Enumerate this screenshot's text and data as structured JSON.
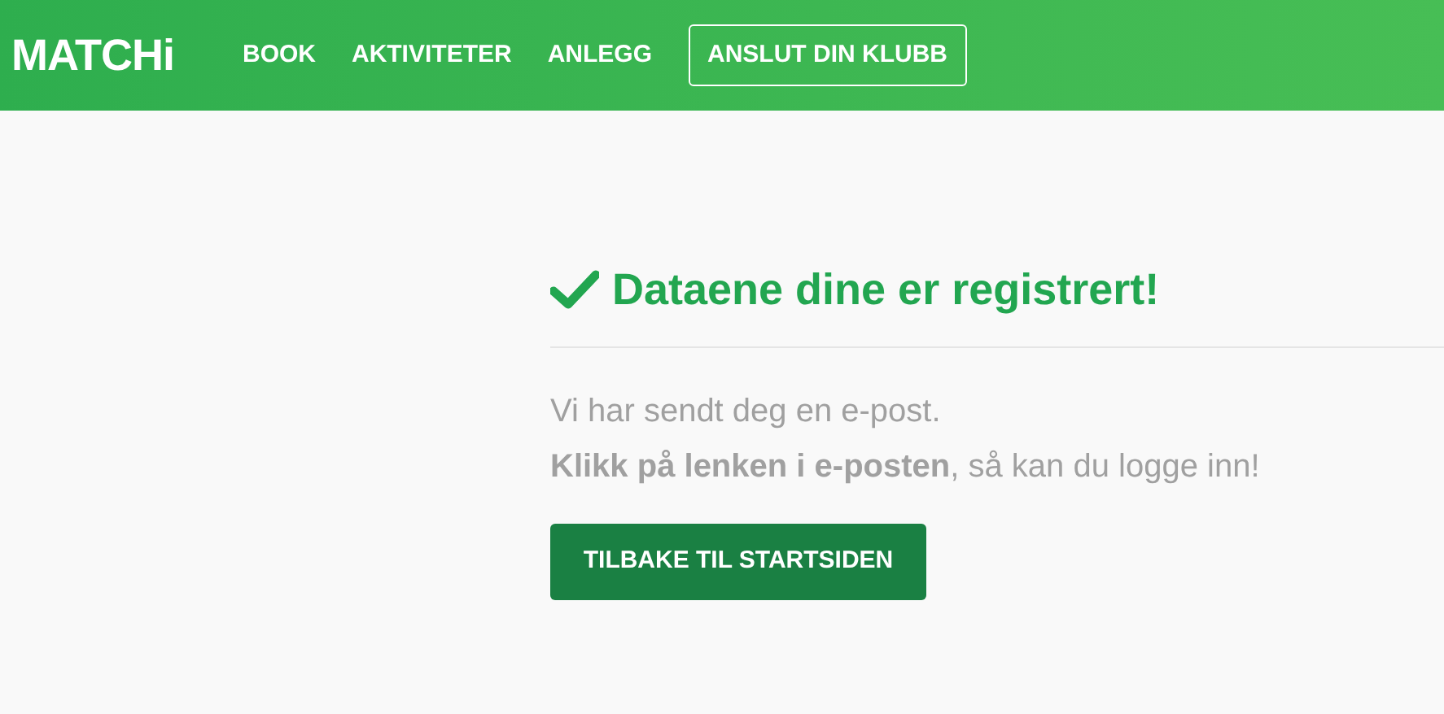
{
  "header": {
    "logo": "MATCHi",
    "nav": [
      {
        "label": "BOOK",
        "kind": "link"
      },
      {
        "label": "AKTIVITETER",
        "kind": "link"
      },
      {
        "label": "ANLEGG",
        "kind": "link"
      },
      {
        "label": "ANSLUT DIN KLUBB",
        "kind": "outlined"
      }
    ]
  },
  "confirmation": {
    "title": "Dataene dine er registrert!",
    "lines": [
      "Vi har sendt deg en e-post.",
      "**Klikk på lenken i e-posten**, så kan du logge inn!"
    ],
    "button": "TILBAKE TIL STARTSIDEN"
  }
}
